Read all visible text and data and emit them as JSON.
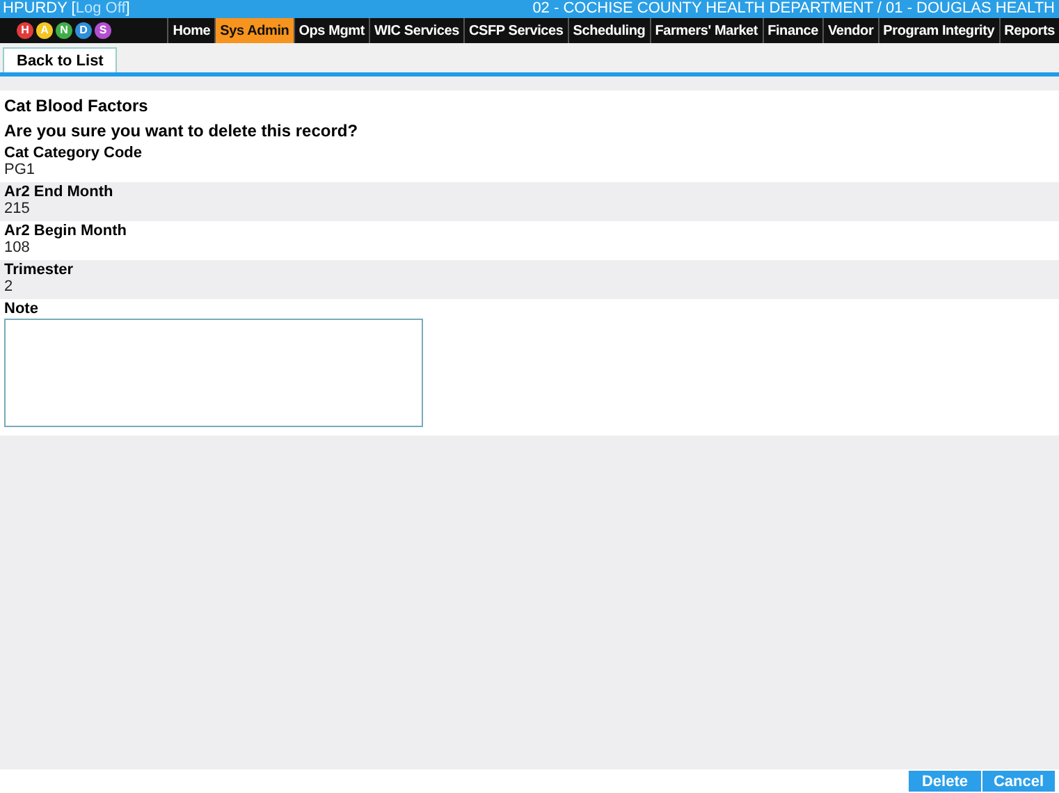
{
  "header": {
    "user": "HPURDY [",
    "logoff": "Log Off",
    "bracket_close": "]",
    "location": "02 - COCHISE COUNTY HEALTH DEPARTMENT / 01 - DOUGLAS HEALTH"
  },
  "logo": {
    "letters": [
      "H",
      "A",
      "N",
      "D",
      "S"
    ]
  },
  "nav": [
    {
      "label": "Home",
      "selected": false
    },
    {
      "label": "Sys Admin",
      "selected": true
    },
    {
      "label": "Ops Mgmt",
      "selected": false
    },
    {
      "label": "WIC Services",
      "selected": false
    },
    {
      "label": "CSFP Services",
      "selected": false
    },
    {
      "label": "Scheduling",
      "selected": false
    },
    {
      "label": "Farmers' Market",
      "selected": false
    },
    {
      "label": "Finance",
      "selected": false
    },
    {
      "label": "Vendor",
      "selected": false
    },
    {
      "label": "Program Integrity",
      "selected": false
    },
    {
      "label": "Reports",
      "selected": false
    }
  ],
  "toolbar": {
    "back_button": "Back to List"
  },
  "title": "Cat Blood Factors",
  "prompt": "Are you sure you want to delete this record?",
  "fields": [
    {
      "label": "Cat Category Code",
      "value": "PG1"
    },
    {
      "label": "Ar2 End Month",
      "value": "215"
    },
    {
      "label": "Ar2 Begin Month",
      "value": "108"
    },
    {
      "label": "Trimester",
      "value": "2"
    }
  ],
  "note": {
    "label": "Note"
  },
  "buttons": [
    "Delete",
    "Cancel"
  ]
}
